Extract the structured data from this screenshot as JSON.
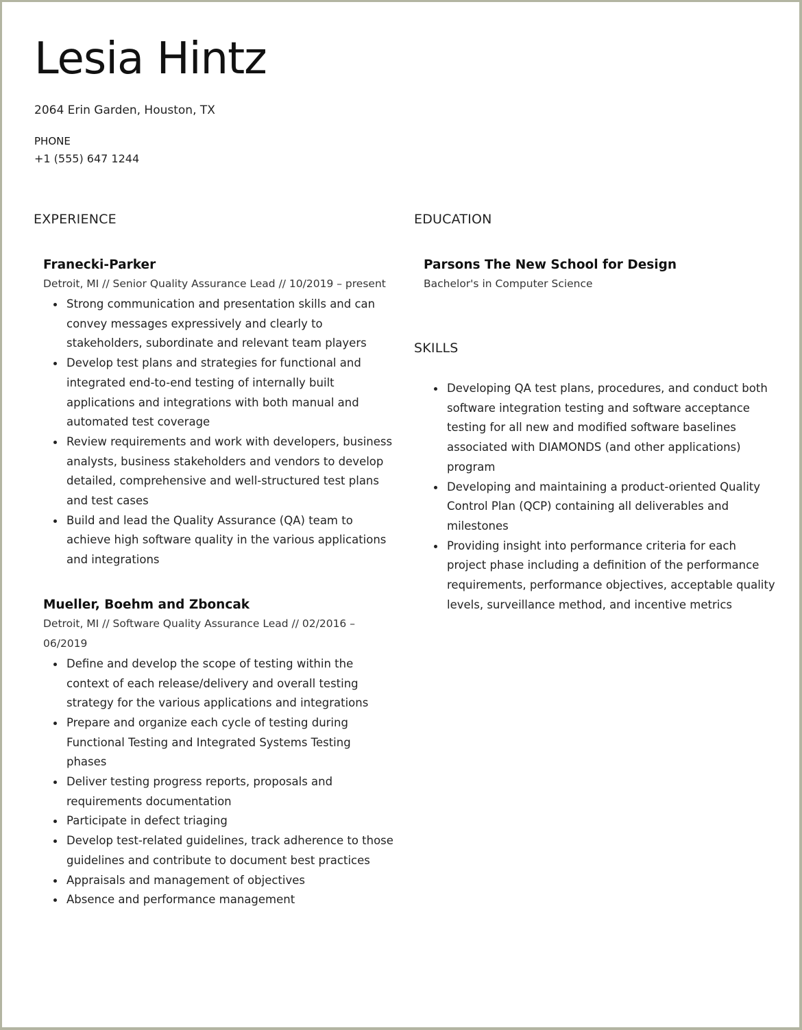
{
  "header": {
    "name": "Lesia Hintz",
    "address": "2064 Erin Garden, Houston, TX",
    "phone_label": "PHONE",
    "phone": "+1 (555) 647 1244"
  },
  "experience": {
    "title": "EXPERIENCE",
    "jobs": [
      {
        "company": "Franecki-Parker",
        "meta": "Detroit, MI // Senior Quality Assurance Lead // 10/2019 – present",
        "bullets": [
          "Strong communication and presentation skills and can convey messages expressively and clearly to stakeholders, subordinate and relevant team players",
          "Develop test plans and strategies for functional and integrated end-to-end testing of internally built applications and integrations with both manual and automated test coverage",
          "Review requirements and work with developers, business analysts, business stakeholders and vendors to develop detailed, comprehensive and well-structured test plans and test cases",
          "Build and lead the Quality Assurance (QA) team to achieve high software quality in the various applications and integrations"
        ]
      },
      {
        "company": "Mueller, Boehm and Zboncak",
        "meta": "Detroit, MI // Software Quality Assurance Lead // 02/2016 – 06/2019",
        "bullets": [
          "Define and develop the scope of testing within the context of each release/delivery and overall testing strategy for the various applications and integrations",
          "Prepare and organize each cycle of testing during Functional Testing and Integrated Systems Testing phases",
          "Deliver testing progress reports, proposals and requirements documentation",
          "Participate in defect triaging",
          "Develop test-related guidelines, track adherence to those guidelines and contribute to document best practices",
          "Appraisals and management of objectives",
          "Absence and performance management"
        ]
      }
    ]
  },
  "education": {
    "title": "EDUCATION",
    "school": "Parsons The New School for Design",
    "degree": "Bachelor's in Computer Science"
  },
  "skills": {
    "title": "SKILLS",
    "items": [
      "Developing QA test plans, procedures, and conduct both software integration testing and software acceptance testing for all new and modified software baselines associated with DIAMONDS (and other applications) program",
      "Developing and maintaining a product-oriented Quality Control Plan (QCP) containing all deliverables and milestones",
      "Providing insight into performance criteria for each project phase including a definition of the performance requirements, performance objectives, acceptable quality levels, surveillance method, and incentive metrics"
    ]
  }
}
